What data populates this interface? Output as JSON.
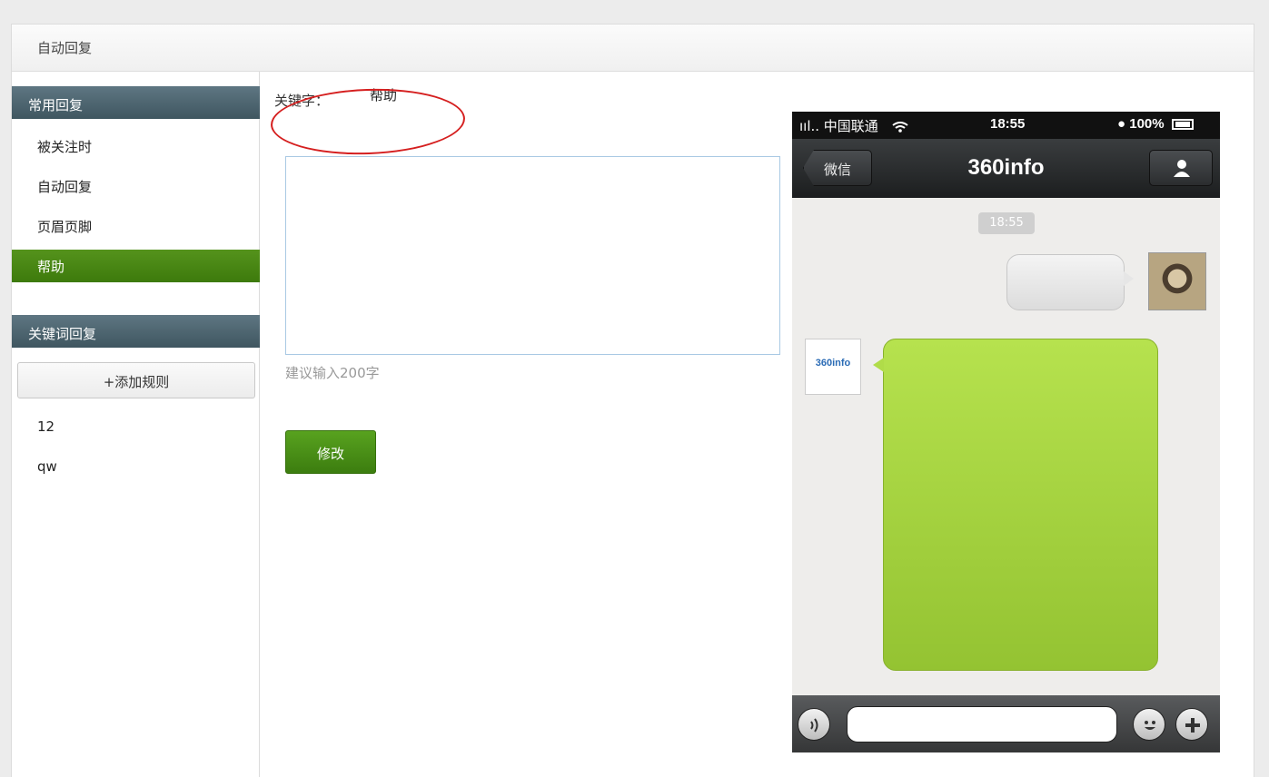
{
  "topbar": {
    "title": "自动回复"
  },
  "sidebar": {
    "common_header": "常用回复",
    "common_items": [
      {
        "label": "被关注时"
      },
      {
        "label": "自动回复"
      },
      {
        "label": "页眉页脚"
      },
      {
        "label": "帮助",
        "active": true
      }
    ],
    "keyword_header": "关键词回复",
    "add_rule_label": "+添加规则",
    "keyword_items": [
      {
        "label": "12"
      },
      {
        "label": "qw"
      }
    ]
  },
  "form": {
    "keyword_label": "关键字：",
    "keyword_value": "帮助",
    "textarea_value": "",
    "hint": "建议输入200字",
    "submit_label": "修改"
  },
  "phone": {
    "status": {
      "carrier": "ııl.. 中国联通",
      "time": "18:55",
      "battery": "● 100%"
    },
    "nav": {
      "back_label": "微信",
      "title": "360info"
    },
    "chat": {
      "time_badge": "18:55",
      "bot_avatar_text": "360info"
    }
  },
  "colors": {
    "accent_green": "#3d7a0c",
    "sidebar_header": "#4a616b",
    "annotation_red": "#d51f1f",
    "bubble_green": "#a6d541"
  }
}
